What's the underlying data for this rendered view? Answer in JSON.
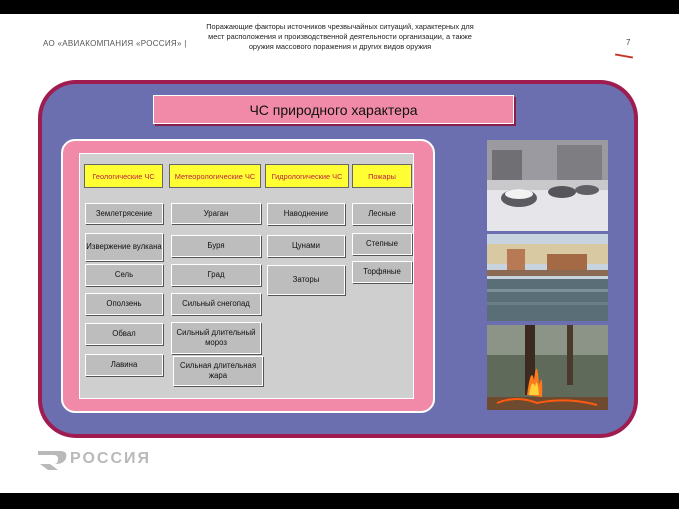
{
  "header": {
    "company": "АО «АВИАКОМПАНИЯ «РОССИЯ» |",
    "title_lines": [
      "Поражающие факторы источников чрезвычайных ситуаций, характерных для",
      "мест расположения и производственной деятельности организации, а также",
      "оружия массового поражения и других видов оружия"
    ],
    "page_number": "7"
  },
  "slide_title": "ЧС природного характера",
  "columns": [
    {
      "header": "Геологические ЧС",
      "items": [
        "Землетрясение",
        "Извержение вулкана",
        "Сель",
        "Оползень",
        "Обвал",
        "Лавина"
      ]
    },
    {
      "header": "Метеорологические ЧС",
      "items": [
        "Ураган",
        "Буря",
        "Град",
        "Сильный снегопад",
        "Сильный длительный мороз",
        "Сильная длительная жара"
      ]
    },
    {
      "header": "Гидрологические ЧС",
      "items": [
        "Наводнение",
        "Цунами",
        "Заторы"
      ]
    },
    {
      "header": "Пожары",
      "items": [
        "Лесные",
        "Степные",
        "Торфяные"
      ]
    }
  ],
  "photos": [
    {
      "icon": "snowstorm-cars-photo"
    },
    {
      "icon": "flood-bridge-photo"
    },
    {
      "icon": "forest-fire-photo"
    }
  ],
  "logo": {
    "text": "РОССИЯ"
  },
  "colors": {
    "outer_frame": "#9e1c50",
    "outer_fill": "#6b6fb0",
    "panel_pink": "#f08aa8",
    "header_yellow": "#ffff33",
    "header_text": "#c02040"
  }
}
